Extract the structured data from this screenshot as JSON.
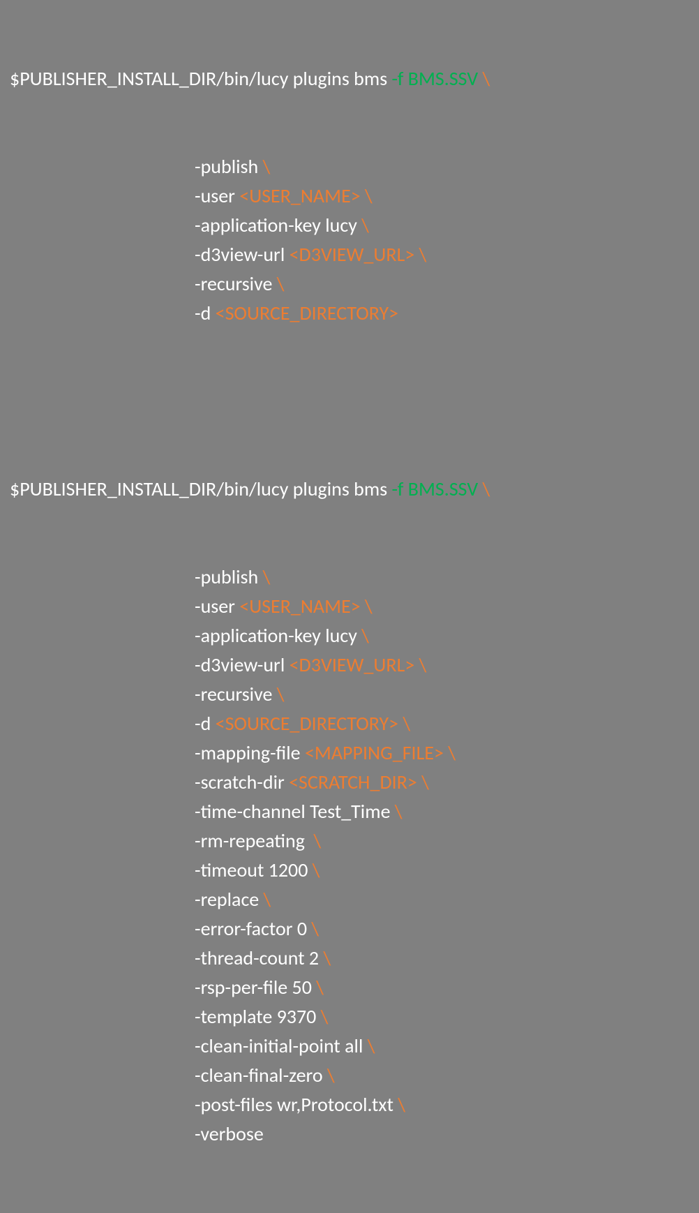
{
  "block1": {
    "line1_cmd": "$PUBLISHER_INSTALL_DIR/bin/lucy plugins bms ",
    "line1_flag": "-f BMS.SSV",
    "line1_cont": " \\",
    "lines": [
      {
        "segs": [
          {
            "t": "-publish ",
            "c": "white"
          },
          {
            "t": "\\",
            "c": "orange"
          }
        ]
      },
      {
        "segs": [
          {
            "t": "-user ",
            "c": "white"
          },
          {
            "t": "<USER_NAME>",
            "c": "orange"
          },
          {
            "t": " ",
            "c": "white"
          },
          {
            "t": "\\",
            "c": "orange"
          }
        ]
      },
      {
        "segs": [
          {
            "t": "-application-key lucy ",
            "c": "white"
          },
          {
            "t": "\\",
            "c": "orange"
          }
        ]
      },
      {
        "segs": [
          {
            "t": "-d3view-url ",
            "c": "white"
          },
          {
            "t": "<D3VIEW_URL>",
            "c": "orange"
          },
          {
            "t": " ",
            "c": "white"
          },
          {
            "t": "\\",
            "c": "orange"
          }
        ]
      },
      {
        "segs": [
          {
            "t": "-recursive ",
            "c": "white"
          },
          {
            "t": "\\",
            "c": "orange"
          }
        ]
      },
      {
        "segs": [
          {
            "t": "-d ",
            "c": "white"
          },
          {
            "t": "<SOURCE_DIRECTORY>",
            "c": "orange"
          }
        ]
      }
    ]
  },
  "block2": {
    "line1_cmd": "$PUBLISHER_INSTALL_DIR/bin/lucy plugins bms ",
    "line1_flag": "-f BMS.SSV",
    "line1_cont": " \\",
    "lines": [
      {
        "segs": [
          {
            "t": "-publish ",
            "c": "white"
          },
          {
            "t": "\\",
            "c": "orange"
          }
        ]
      },
      {
        "segs": [
          {
            "t": "-user ",
            "c": "white"
          },
          {
            "t": "<USER_NAME>",
            "c": "orange"
          },
          {
            "t": " ",
            "c": "white"
          },
          {
            "t": "\\",
            "c": "orange"
          }
        ]
      },
      {
        "segs": [
          {
            "t": "-application-key lucy ",
            "c": "white"
          },
          {
            "t": "\\",
            "c": "orange"
          }
        ]
      },
      {
        "segs": [
          {
            "t": "-d3view-url ",
            "c": "white"
          },
          {
            "t": "<D3VIEW_URL>",
            "c": "orange"
          },
          {
            "t": " ",
            "c": "white"
          },
          {
            "t": "\\",
            "c": "orange"
          }
        ]
      },
      {
        "segs": [
          {
            "t": "-recursive ",
            "c": "white"
          },
          {
            "t": "\\",
            "c": "orange"
          }
        ]
      },
      {
        "segs": [
          {
            "t": "-d ",
            "c": "white"
          },
          {
            "t": "<SOURCE_DIRECTORY>",
            "c": "orange"
          },
          {
            "t": " ",
            "c": "white"
          },
          {
            "t": "\\",
            "c": "orange"
          }
        ]
      },
      {
        "segs": [
          {
            "t": "-mapping-file ",
            "c": "white"
          },
          {
            "t": "<MAPPING_FILE>",
            "c": "orange"
          },
          {
            "t": " ",
            "c": "white"
          },
          {
            "t": "\\",
            "c": "orange"
          }
        ]
      },
      {
        "segs": [
          {
            "t": "-scratch-dir ",
            "c": "white"
          },
          {
            "t": "<SCRATCH_DIR>",
            "c": "orange"
          },
          {
            "t": " ",
            "c": "white"
          },
          {
            "t": "\\",
            "c": "orange"
          }
        ]
      },
      {
        "segs": [
          {
            "t": "-time-channel Test_Time ",
            "c": "white"
          },
          {
            "t": "\\",
            "c": "orange"
          }
        ]
      },
      {
        "segs": [
          {
            "t": "-rm-repeating  ",
            "c": "white"
          },
          {
            "t": "\\",
            "c": "orange"
          }
        ]
      },
      {
        "segs": [
          {
            "t": "-timeout 1200 ",
            "c": "white"
          },
          {
            "t": "\\",
            "c": "orange"
          }
        ]
      },
      {
        "segs": [
          {
            "t": "-replace ",
            "c": "white"
          },
          {
            "t": "\\",
            "c": "orange"
          }
        ]
      },
      {
        "segs": [
          {
            "t": "-error-factor 0 ",
            "c": "white"
          },
          {
            "t": "\\",
            "c": "orange"
          }
        ]
      },
      {
        "segs": [
          {
            "t": "-thread-count 2 ",
            "c": "white"
          },
          {
            "t": "\\",
            "c": "orange"
          }
        ]
      },
      {
        "segs": [
          {
            "t": "-rsp-per-file 50 ",
            "c": "white"
          },
          {
            "t": "\\",
            "c": "orange"
          }
        ]
      },
      {
        "segs": [
          {
            "t": "-template 9370 ",
            "c": "white"
          },
          {
            "t": "\\",
            "c": "orange"
          }
        ]
      },
      {
        "segs": [
          {
            "t": "-clean-initial-point all ",
            "c": "white"
          },
          {
            "t": "\\",
            "c": "orange"
          }
        ]
      },
      {
        "segs": [
          {
            "t": "-clean-final-zero ",
            "c": "white"
          },
          {
            "t": "\\",
            "c": "orange"
          }
        ]
      },
      {
        "segs": [
          {
            "t": "-post-files wr,Protocol.txt ",
            "c": "white"
          },
          {
            "t": "\\",
            "c": "orange"
          }
        ]
      },
      {
        "segs": [
          {
            "t": "-verbose",
            "c": "white"
          }
        ]
      }
    ]
  }
}
